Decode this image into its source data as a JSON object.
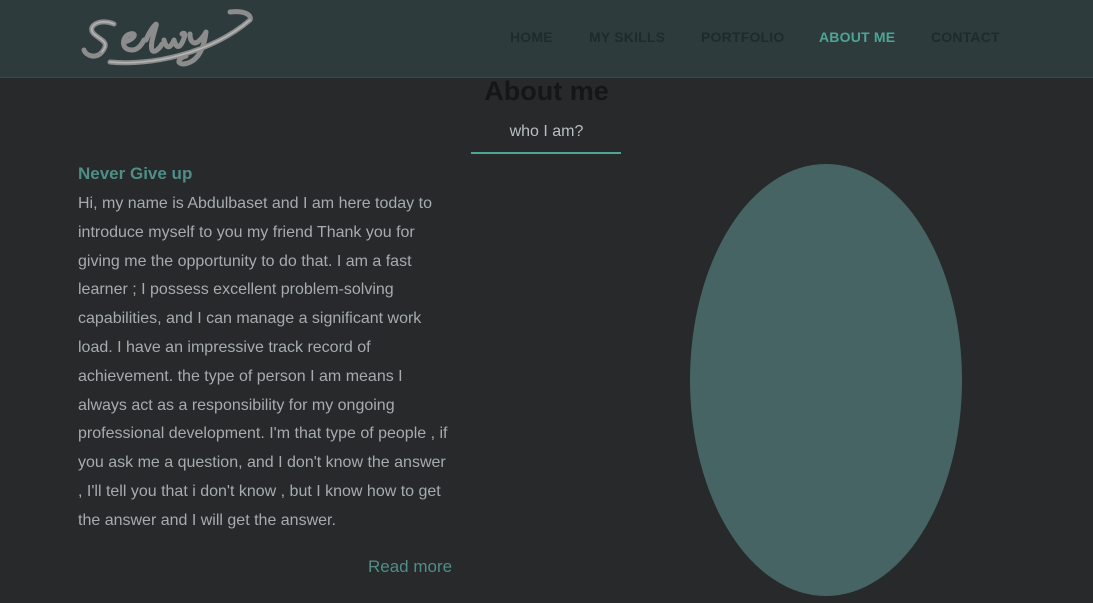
{
  "header": {
    "logo_text": "Selwy",
    "nav": [
      {
        "label": "HOME",
        "active": false
      },
      {
        "label": "MY SKILLS",
        "active": false
      },
      {
        "label": "PORTFOLIO",
        "active": false
      },
      {
        "label": "ABOUT ME",
        "active": true
      },
      {
        "label": "CONTACT",
        "active": false
      }
    ]
  },
  "about": {
    "title": "About me",
    "subtitle": "who I am?",
    "heading": "Never Give up",
    "bio": "Hi, my name is Abdulbaset and I am here today to introduce myself to you my friend Thank you for giving me the opportunity to do that. I am a fast learner ; I possess excellent problem-solving capabilities, and I can manage a significant work load. I have an impressive track record of achievement. the type of person I am means I always act as a responsibility for my ongoing professional development. I'm that type of people , if you ask me a question, and I don't know the answer , I'll tell you that i don't know , but I know how to get the answer and I will get the answer.",
    "read_more": "Read more"
  },
  "colors": {
    "background": "#27292b",
    "navbar": "#2e3b3c",
    "accent": "#4ea596",
    "heading_accent": "#4f8e86",
    "photo_placeholder": "#466464"
  }
}
